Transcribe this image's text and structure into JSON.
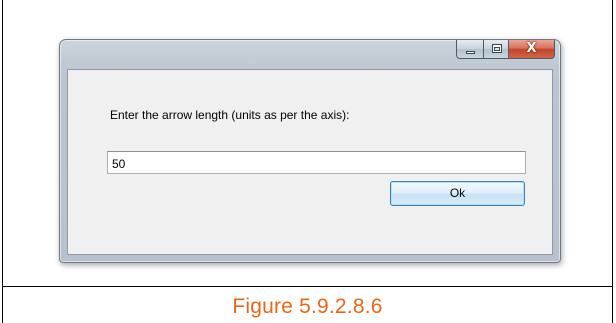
{
  "dialog": {
    "prompt": "Enter the arrow length (units as per the axis):",
    "input_value": "50",
    "ok_label": "Ok",
    "close_glyph": "X"
  },
  "caption": {
    "text": "Figure 5.9.2.8.6"
  },
  "colors": {
    "caption": "#e8661a",
    "close_button": "#c4452b",
    "ok_border": "#3c7fb1"
  }
}
